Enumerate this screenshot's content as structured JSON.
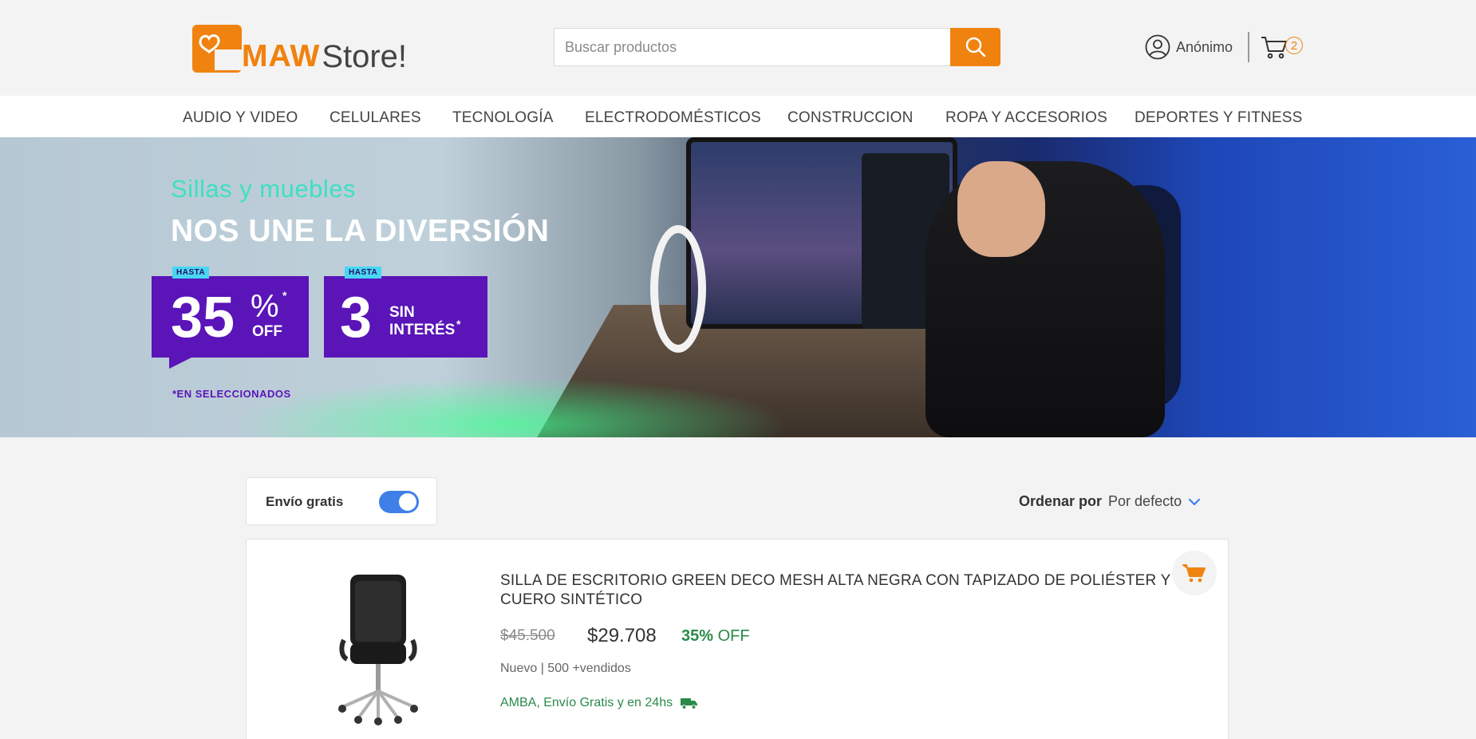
{
  "header": {
    "logo_brand": "MAW",
    "logo_store": "Store!",
    "search_placeholder": "Buscar productos",
    "search_icon": "search-icon",
    "user_label": "Anónimo",
    "user_icon": "user-circle-icon",
    "cart_icon": "cart-icon",
    "cart_count": "2"
  },
  "nav": {
    "items": [
      "AUDIO Y VIDEO",
      "CELULARES",
      "TECNOLOGÍA",
      "ELECTRODOMÉSTICOS",
      "CONSTRUCCION",
      "ROPA Y ACCESORIOS",
      "DEPORTES Y FITNESS"
    ]
  },
  "banner": {
    "subtitle": "Sillas y muebles",
    "title": "NOS UNE LA DIVERSIÓN",
    "promo1": {
      "tag": "HASTA",
      "big": "35",
      "symbol": "%",
      "asterisk": "*",
      "small": "OFF"
    },
    "promo2": {
      "tag": "HASTA",
      "big": "3",
      "line1": "SIN",
      "line2": "INTERÉS",
      "asterisk": "*"
    },
    "footnote": "*EN SELECCIONADOS"
  },
  "filters": {
    "free_shipping_label": "Envío gratis",
    "free_shipping_on": true,
    "sort_label": "Ordenar por",
    "sort_value": "Por defecto"
  },
  "product": {
    "title": "SILLA DE ESCRITORIO GREEN DECO MESH ALTA NEGRA CON TAPIZADO DE POLIÉSTER Y CUERO SINTÉTICO",
    "old_price": "$45.500",
    "new_price": "$29.708",
    "discount_value": "35%",
    "discount_suffix": "OFF",
    "condition": "Nuevo | 500 +vendidos",
    "shipping": "AMBA, Envío Gratis y en 24hs",
    "shipping_icon": "truck-icon",
    "add_cart_icon": "cart-add-icon"
  },
  "colors": {
    "accent": "#f0820f",
    "toggle": "#3f7fe8",
    "success": "#2a8a4a",
    "promo": "#5a14b8"
  }
}
